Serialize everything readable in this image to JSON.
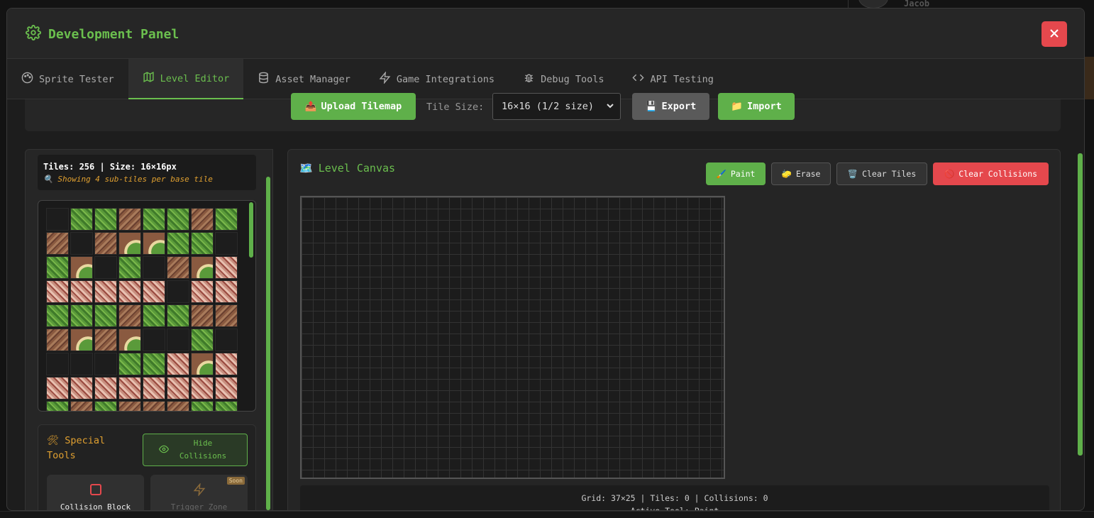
{
  "background": {
    "user_name": "Jacob"
  },
  "modal": {
    "title": "Development Panel",
    "close_icon": "close-icon",
    "title_icon": "gear-icon"
  },
  "tabs": [
    {
      "label": "Sprite Tester",
      "icon": "palette-icon",
      "active": false
    },
    {
      "label": "Level Editor",
      "icon": "map-icon",
      "active": true
    },
    {
      "label": "Asset Manager",
      "icon": "database-icon",
      "active": false
    },
    {
      "label": "Game Integrations",
      "icon": "lightning-icon",
      "active": false
    },
    {
      "label": "Debug Tools",
      "icon": "bug-icon",
      "active": false
    },
    {
      "label": "API Testing",
      "icon": "code-icon",
      "active": false
    }
  ],
  "toolbar": {
    "upload_label": "Upload Tilemap",
    "tile_size_label": "Tile Size:",
    "tile_size_value": "16×16 (1/2 size)",
    "export_label": "Export",
    "import_label": "Import"
  },
  "tileset": {
    "info": "Tiles: 256 | Size: 16×16px",
    "note": "Showing 4 sub-tiles per base tile"
  },
  "special_tools": {
    "title": "Special Tools",
    "hide_collisions_label": "Hide Collisions",
    "collision_block_label": "Collision Block",
    "trigger_zone_label": "Trigger Zone",
    "soon_badge": "Soon"
  },
  "canvas": {
    "title": "Level Canvas",
    "paint_label": "Paint",
    "erase_label": "Erase",
    "clear_tiles_label": "Clear Tiles",
    "clear_collisions_label": "Clear Collisions",
    "status_line1": "Grid: 37×25 | Tiles: 0 | Collisions: 0",
    "status_line2": "Active Tool: Paint"
  },
  "colors": {
    "accent": "#5fb04a",
    "danger": "#e5484d",
    "warning_text": "#e0a030"
  }
}
